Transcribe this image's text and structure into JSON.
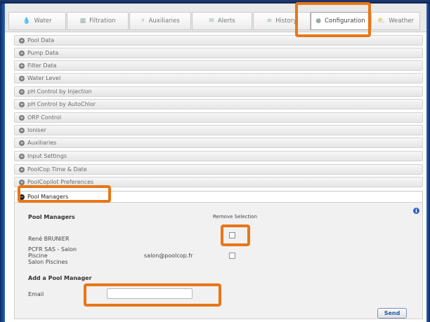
{
  "tabs": [
    {
      "label": "Water",
      "icon": "droplet-icon"
    },
    {
      "label": "Filtration",
      "icon": "filter-icon"
    },
    {
      "label": "Auxiliaries",
      "icon": "plug-icon"
    },
    {
      "label": "Alerts",
      "icon": "envelope-icon"
    },
    {
      "label": "History",
      "icon": "chart-icon"
    },
    {
      "label": "Configuration",
      "icon": "gear-icon",
      "active": true
    },
    {
      "label": "Weather",
      "icon": "weather-icon"
    }
  ],
  "accordion": [
    "Pool Data",
    "Pump Data",
    "Filter Data",
    "Water Level",
    "pH Control by Injection",
    "pH Control by AutoChlor",
    "ORP Control",
    "Ioniser",
    "Auxiliaries",
    "Input Settings",
    "PoolCop Time & Date",
    "PoolCopilot Preferences"
  ],
  "open_section": {
    "title": "Pool Managers",
    "heading": "Pool Managers",
    "remove_label": "Remove Selection",
    "managers": [
      {
        "name": "René BRUNIER",
        "email": "",
        "selected": false
      },
      {
        "name_lines": [
          "PCFR SAS - Salon",
          "Piscine",
          "Salon Piscines"
        ],
        "email": "salon@poolcop.fr",
        "selected": false
      }
    ],
    "add_heading": "Add a Pool Manager",
    "email_label": "Email",
    "email_value": "",
    "send_label": "Send"
  },
  "highlight_color": "#e87617"
}
